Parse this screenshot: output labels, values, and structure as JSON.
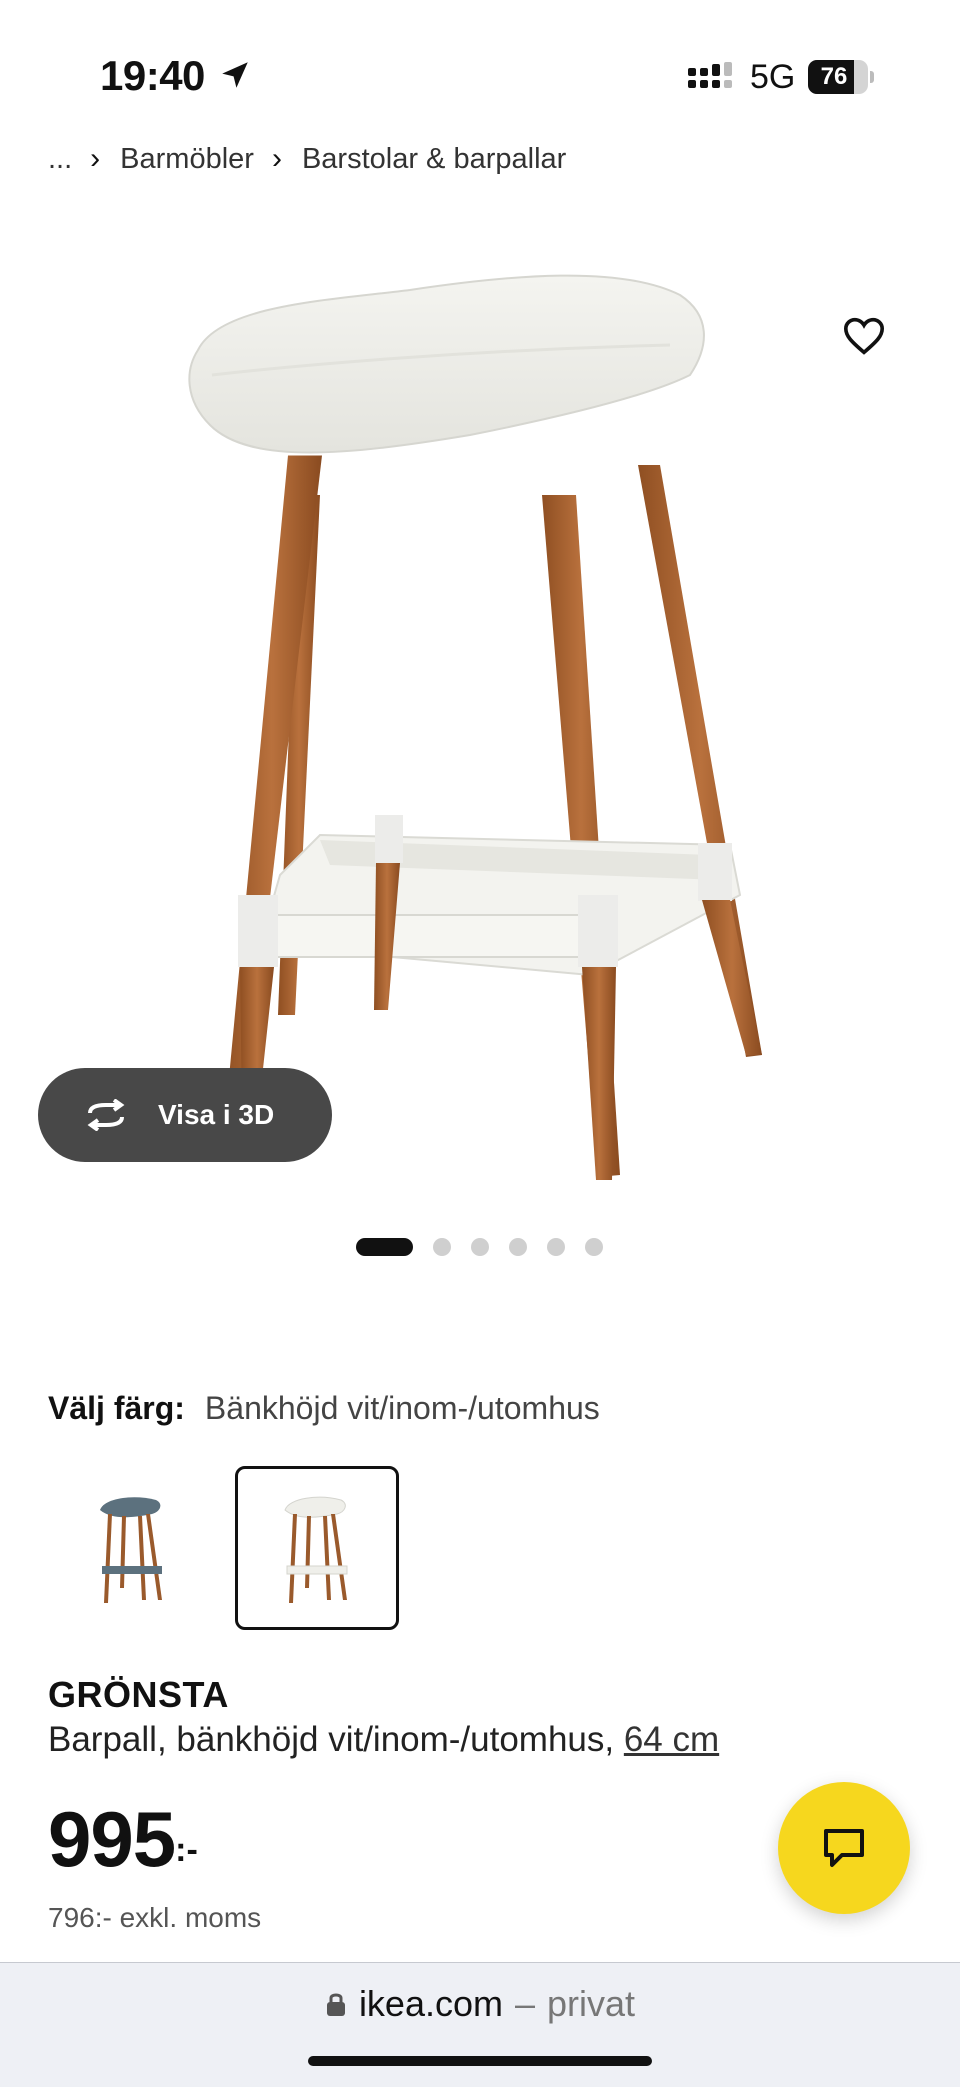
{
  "status_bar": {
    "time": "19:40",
    "network": "5G",
    "battery_level": "76",
    "location_icon": "location-arrow-icon",
    "signal_icon": "signal-bars-icon"
  },
  "breadcrumb": {
    "ellipsis": "...",
    "items": [
      "Barmöbler",
      "Barstolar & barpallar"
    ]
  },
  "gallery": {
    "view_3d_label": "Visa i 3D",
    "dot_count": 6,
    "active_dot": 0,
    "favorite_icon": "heart-outline-icon"
  },
  "color_picker": {
    "label": "Välj färg:",
    "selected_value": "Bänkhöjd vit/inom-/utomhus",
    "swatches": [
      {
        "name": "blue-grey",
        "selected": false
      },
      {
        "name": "white",
        "selected": true
      }
    ]
  },
  "product": {
    "name": "GRÖNSTA",
    "description": "Barpall, bänkhöjd vit/inom-/utomhus, ",
    "size": "64 cm",
    "price": "995",
    "price_suffix": ":-",
    "price_ex_vat": "796:- exkl. moms"
  },
  "chat": {
    "icon": "chat-bubble-icon"
  },
  "browser": {
    "domain": "ikea.com",
    "separator": "–",
    "mode": "privat"
  },
  "colors": {
    "chat_button": "#f6d71e",
    "view_3d_button": "#484848"
  }
}
